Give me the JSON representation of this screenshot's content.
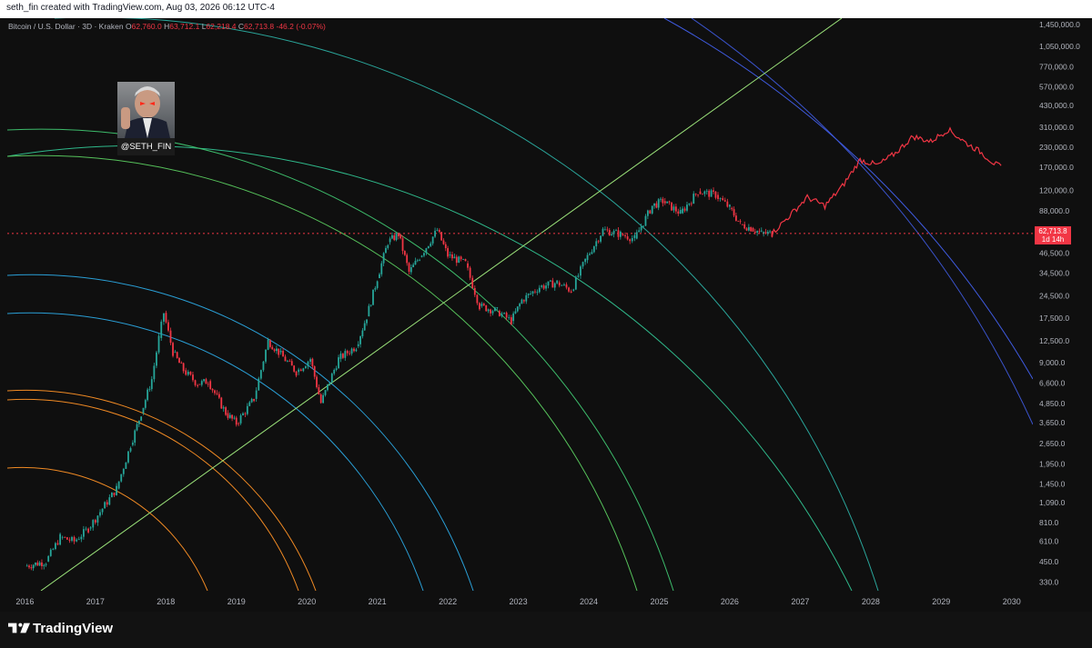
{
  "header": {
    "attribution": "seth_fin created with TradingView.com, Aug 03, 2026 06:12 UTC-4"
  },
  "legend": {
    "symbol": "Bitcoin / U.S. Dollar · 3D · Kraken",
    "open": "62,760.0",
    "high": "63,712.1",
    "low": "62,218.4",
    "close": "62,713.8",
    "change": "-46.2 (-0.07%)"
  },
  "price_badge": {
    "price": "62,713.8",
    "countdown": "1d 14h"
  },
  "avatar": {
    "label": "@SETH_FIN"
  },
  "brand": {
    "name": "TradingView"
  },
  "colors": {
    "up": "#26a69a",
    "down": "#f23645",
    "projection": "#f23645",
    "trendline": "#9be37a",
    "background": "#0f0f0f"
  },
  "chart_data": {
    "type": "line",
    "title": "",
    "xlabel": "",
    "ylabel": "",
    "y_scale": "log",
    "ylim": [
      290,
      1600000
    ],
    "xlim": [
      2015.75,
      2030.3
    ],
    "x_ticks": [
      "2016",
      "2017",
      "2018",
      "2019",
      "2020",
      "2021",
      "2022",
      "2023",
      "2024",
      "2025",
      "2026",
      "2027",
      "2028",
      "2029",
      "2030"
    ],
    "y_ticks": [
      "1,450,000.0",
      "1,050,000.0",
      "770,000.0",
      "570,000.0",
      "430,000.0",
      "310,000.0",
      "230,000.0",
      "170,000.0",
      "120,000.0",
      "88,000.0",
      "62,713.8",
      "46,500.0",
      "34,500.0",
      "24,500.0",
      "17,500.0",
      "12,500.0",
      "9,000.0",
      "6,600.0",
      "4,850.0",
      "3,650.0",
      "2,650.0",
      "1,950.0",
      "1,450.0",
      "1,090.0",
      "810.0",
      "610.0",
      "450.0",
      "330.0"
    ],
    "last_price": 62713.8,
    "series": [
      {
        "values": [
          [
            2016.0,
            420
          ],
          [
            2016.3,
            450
          ],
          [
            2016.5,
            650
          ],
          [
            2016.7,
            610
          ],
          [
            2016.9,
            740
          ],
          [
            2017.1,
            1000
          ],
          [
            2017.3,
            1350
          ],
          [
            2017.5,
            2600
          ],
          [
            2017.65,
            4200
          ],
          [
            2017.8,
            7000
          ],
          [
            2017.9,
            13000
          ],
          [
            2017.97,
            19000
          ],
          [
            2018.1,
            10500
          ],
          [
            2018.25,
            8000
          ],
          [
            2018.45,
            6500
          ],
          [
            2018.6,
            6800
          ],
          [
            2018.85,
            4200
          ],
          [
            2019.0,
            3600
          ],
          [
            2019.25,
            5200
          ],
          [
            2019.45,
            12500
          ],
          [
            2019.6,
            10500
          ],
          [
            2019.85,
            7800
          ],
          [
            2020.05,
            9500
          ],
          [
            2020.2,
            4900
          ],
          [
            2020.45,
            9500
          ],
          [
            2020.7,
            11500
          ],
          [
            2020.85,
            18000
          ],
          [
            2021.0,
            32000
          ],
          [
            2021.15,
            55000
          ],
          [
            2021.3,
            62000
          ],
          [
            2021.45,
            35000
          ],
          [
            2021.6,
            44000
          ],
          [
            2021.85,
            66000
          ],
          [
            2022.0,
            45000
          ],
          [
            2022.25,
            40000
          ],
          [
            2022.45,
            21000
          ],
          [
            2022.7,
            19500
          ],
          [
            2022.9,
            16800
          ],
          [
            2023.05,
            23000
          ],
          [
            2023.3,
            28000
          ],
          [
            2023.55,
            30000
          ],
          [
            2023.75,
            26500
          ],
          [
            2023.95,
            42000
          ],
          [
            2024.2,
            66000
          ],
          [
            2024.45,
            62000
          ],
          [
            2024.65,
            58000
          ],
          [
            2024.9,
            95000
          ],
          [
            2025.05,
            102000
          ],
          [
            2025.3,
            85000
          ],
          [
            2025.55,
            118000
          ],
          [
            2025.8,
            112000
          ],
          [
            2026.0,
            92000
          ],
          [
            2026.15,
            72000
          ],
          [
            2026.3,
            68000
          ],
          [
            2026.45,
            63000
          ],
          [
            2026.6,
            62713.8
          ]
        ]
      },
      {
        "values": [
          [
            2026.6,
            62713.8
          ],
          [
            2026.85,
            82000
          ],
          [
            2027.1,
            108000
          ],
          [
            2027.35,
            95000
          ],
          [
            2027.6,
            128000
          ],
          [
            2027.85,
            190000
          ],
          [
            2028.1,
            175000
          ],
          [
            2028.35,
            210000
          ],
          [
            2028.6,
            270000
          ],
          [
            2028.85,
            250000
          ],
          [
            2029.1,
            300000
          ],
          [
            2029.35,
            245000
          ],
          [
            2029.55,
            215000
          ],
          [
            2029.75,
            180000
          ],
          [
            2029.85,
            170000
          ]
        ]
      }
    ]
  }
}
